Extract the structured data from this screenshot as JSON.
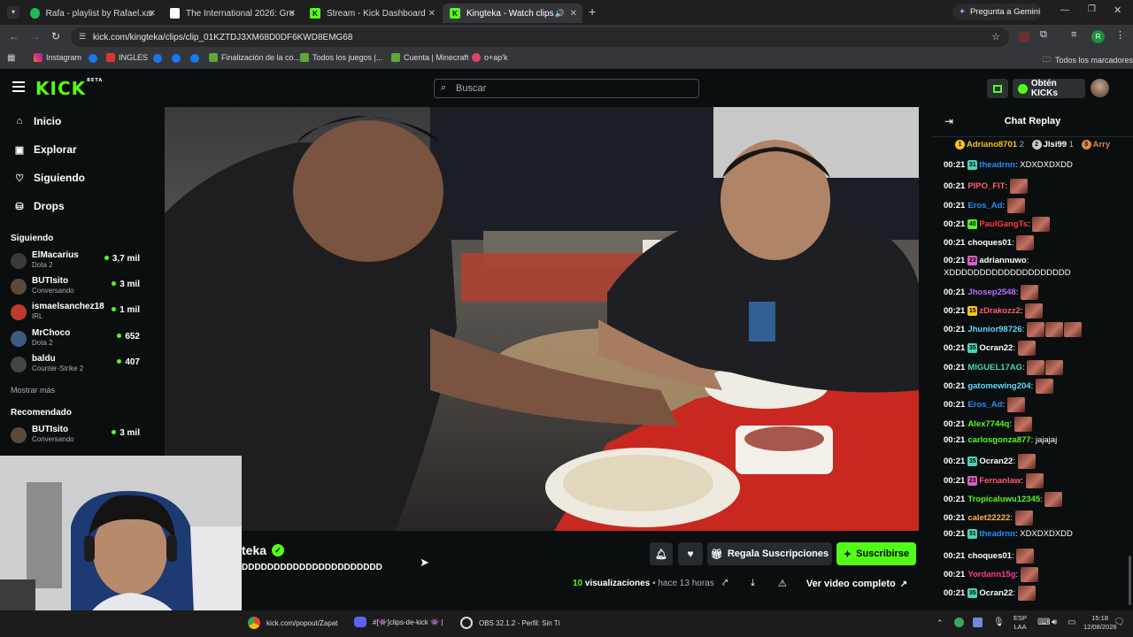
{
  "browser": {
    "tabs": [
      {
        "label": "Rafa - playlist by Rafael.xared |",
        "color": "#1db954"
      },
      {
        "label": "The International 2026: Group",
        "color": "#ffffff"
      },
      {
        "label": "Stream - Kick Dashboard",
        "color": "#53fc18"
      },
      {
        "label": "Kingteka - Watch clips on K",
        "color": "#53fc18"
      }
    ],
    "gemini_label": "Pregunta a Gemini",
    "url": "kick.com/kingteka/clips/clip_01KZTDJ3XM68D0DF6KWD8EMG68",
    "profile_initial": "R",
    "bookmarks": [
      "Instagram",
      "INGLES",
      "Finalización de la co...",
      "Todos los juegos |...",
      "Cuenta | Minecraft",
      "o+ap'k"
    ],
    "all_bookmarks": "Todos los marcadores"
  },
  "kick": {
    "logo": "KICK",
    "logo_beta": "BETA",
    "search_placeholder": "Buscar",
    "get_kicks": "Obtén KICKs"
  },
  "sidebar": {
    "nav": [
      {
        "label": "Inicio",
        "icon": "home-icon",
        "glyph": "⌂"
      },
      {
        "label": "Explorar",
        "icon": "compass-icon",
        "glyph": "▣"
      },
      {
        "label": "Siguiendo",
        "icon": "heart-icon",
        "glyph": "♡"
      },
      {
        "label": "Drops",
        "icon": "drops-icon",
        "glyph": "⛁"
      }
    ],
    "following_title": "Siguiendo",
    "following": [
      {
        "name": "ElMacarius",
        "category": "Dota 2",
        "viewers": "3,7 mil",
        "color": "#3a3a3a"
      },
      {
        "name": "BUTIsito",
        "category": "Conversando",
        "viewers": "3 mil",
        "color": "#5b4a3a"
      },
      {
        "name": "ismaelsanchez18",
        "category": "IRL",
        "viewers": "1 mil",
        "color": "#c0392b"
      },
      {
        "name": "MrChoco",
        "category": "Dota 2",
        "viewers": "652",
        "color": "#3d5a80"
      },
      {
        "name": "baldu",
        "category": "Counter-Strike 2",
        "viewers": "407",
        "color": "#444444"
      }
    ],
    "show_more": "Mostrar más",
    "recommended_title": "Recomendado",
    "recommended": [
      {
        "name": "BUTIsito",
        "category": "Conversando",
        "viewers": "3 mil",
        "color": "#5b4a3a"
      }
    ]
  },
  "clip": {
    "channel": "teka",
    "title": "DDDDDDDDDDDDDDDDDDDDDD",
    "views_count": "10",
    "views_label": "visualizaciones",
    "time_ago": "• hace 13 horas",
    "gift_subs": "Regala Suscripciones",
    "subscribe": "Suscribirse",
    "full_video": "Ver video completo"
  },
  "chat": {
    "title": "Chat Replay",
    "top_gifters": [
      {
        "name": "Adriano8701",
        "count": "2",
        "color": "#f5c518"
      },
      {
        "name": "Jlsi99",
        "count": "1",
        "color": "#c9c9c9"
      },
      {
        "name": "Arry",
        "count": "",
        "color": "#d9884a"
      }
    ],
    "messages": [
      {
        "time": "00:21",
        "user": "theadrnn",
        "color": "#1e90ff",
        "badge": "31",
        "badge_color": "#44d7b6",
        "text": "XDXDXDXDD",
        "emotes": 0
      },
      {
        "time": "00:21",
        "user": "PIPO_FIT",
        "color": "#ff5a6e",
        "badge": "",
        "badge_color": "",
        "text": "",
        "emotes": 1
      },
      {
        "time": "00:21",
        "user": "Eros_Ad",
        "color": "#1e90ff",
        "badge": "",
        "badge_color": "",
        "text": "",
        "emotes": 1
      },
      {
        "time": "00:21",
        "user": "PaulGangTs",
        "color": "#ff3b3b",
        "badge": "40",
        "badge_color": "#53fc18",
        "text": "",
        "emotes": 1
      },
      {
        "time": "00:21",
        "user": "choques01",
        "color": "#ffffff",
        "badge": "",
        "badge_color": "",
        "text": "",
        "emotes": 1
      },
      {
        "time": "00:21",
        "user": "adriannuwo",
        "color": "#ffffff",
        "badge": "23",
        "badge_color": "#e05cc7",
        "text": "XDDDDDDDDDDDDDDDDDDDD",
        "emotes": 0
      },
      {
        "time": "00:21",
        "user": "Jhosep2548",
        "color": "#b76cff",
        "badge": "",
        "badge_color": "",
        "text": "",
        "emotes": 1
      },
      {
        "time": "00:21",
        "user": "zDrakozz2",
        "color": "#ff5a6e",
        "badge": "15",
        "badge_color": "#f5c518",
        "text": "",
        "emotes": 1
      },
      {
        "time": "00:21",
        "user": "Jhunior98726",
        "color": "#5dd9ff",
        "badge": "",
        "badge_color": "",
        "text": "",
        "emotes": 3
      },
      {
        "time": "00:21",
        "user": "Ocran22",
        "color": "#ffffff",
        "badge": "35",
        "badge_color": "#44d7b6",
        "text": "",
        "emotes": 1
      },
      {
        "time": "00:21",
        "user": "MIGUEL17AG",
        "color": "#44d7b6",
        "badge": "",
        "badge_color": "",
        "text": "",
        "emotes": 2
      },
      {
        "time": "00:21",
        "user": "gatomewing204",
        "color": "#5dd9ff",
        "badge": "",
        "badge_color": "",
        "text": "",
        "emotes": 1
      },
      {
        "time": "00:21",
        "user": "Eros_Ad",
        "color": "#1e90ff",
        "badge": "",
        "badge_color": "",
        "text": "",
        "emotes": 1
      },
      {
        "time": "00:21",
        "user": "Alex7744q",
        "color": "#53fc18",
        "badge": "",
        "badge_color": "",
        "text": "",
        "emotes": 1
      },
      {
        "time": "00:21",
        "user": "carlosgonza877",
        "color": "#53fc18",
        "badge": "",
        "badge_color": "",
        "text": "jajajaj",
        "emotes": 0
      },
      {
        "time": "00:21",
        "user": "Ocran22",
        "color": "#ffffff",
        "badge": "35",
        "badge_color": "#44d7b6",
        "text": "",
        "emotes": 1
      },
      {
        "time": "00:21",
        "user": "Fernanlaw",
        "color": "#ff5a6e",
        "badge": "23",
        "badge_color": "#e05cc7",
        "text": "",
        "emotes": 1
      },
      {
        "time": "00:21",
        "user": "Tropicaluwu12345",
        "color": "#53fc18",
        "badge": "",
        "badge_color": "",
        "text": "",
        "emotes": 1
      },
      {
        "time": "00:21",
        "user": "calet22222",
        "color": "#ffb347",
        "badge": "",
        "badge_color": "",
        "text": "",
        "emotes": 1
      },
      {
        "time": "00:21",
        "user": "theadrnn",
        "color": "#1e90ff",
        "badge": "31",
        "badge_color": "#44d7b6",
        "text": "XDXDXDXDD",
        "emotes": 0
      },
      {
        "time": "00:21",
        "user": "choques01",
        "color": "#ffffff",
        "badge": "",
        "badge_color": "",
        "text": "",
        "emotes": 1
      },
      {
        "time": "00:21",
        "user": "Yordann15g",
        "color": "#ff3b8a",
        "badge": "",
        "badge_color": "",
        "text": "",
        "emotes": 1
      },
      {
        "time": "00:21",
        "user": "Ocran22",
        "color": "#ffffff",
        "badge": "35",
        "badge_color": "#44d7b6",
        "text": "",
        "emotes": 1
      }
    ]
  },
  "taskbar": {
    "apps": [
      "kick.com/popout/Zapat",
      "#[👾]clips-de-kick 👾 |",
      "OBS 32.1.2 - Perfil: Sin Tí"
    ],
    "lang": "ESP",
    "lang_sub": "LAA",
    "time": "15:18",
    "date": "12/08/2026"
  },
  "colors": {
    "kick_green": "#53fc18",
    "bg": "#0b0e0f"
  }
}
